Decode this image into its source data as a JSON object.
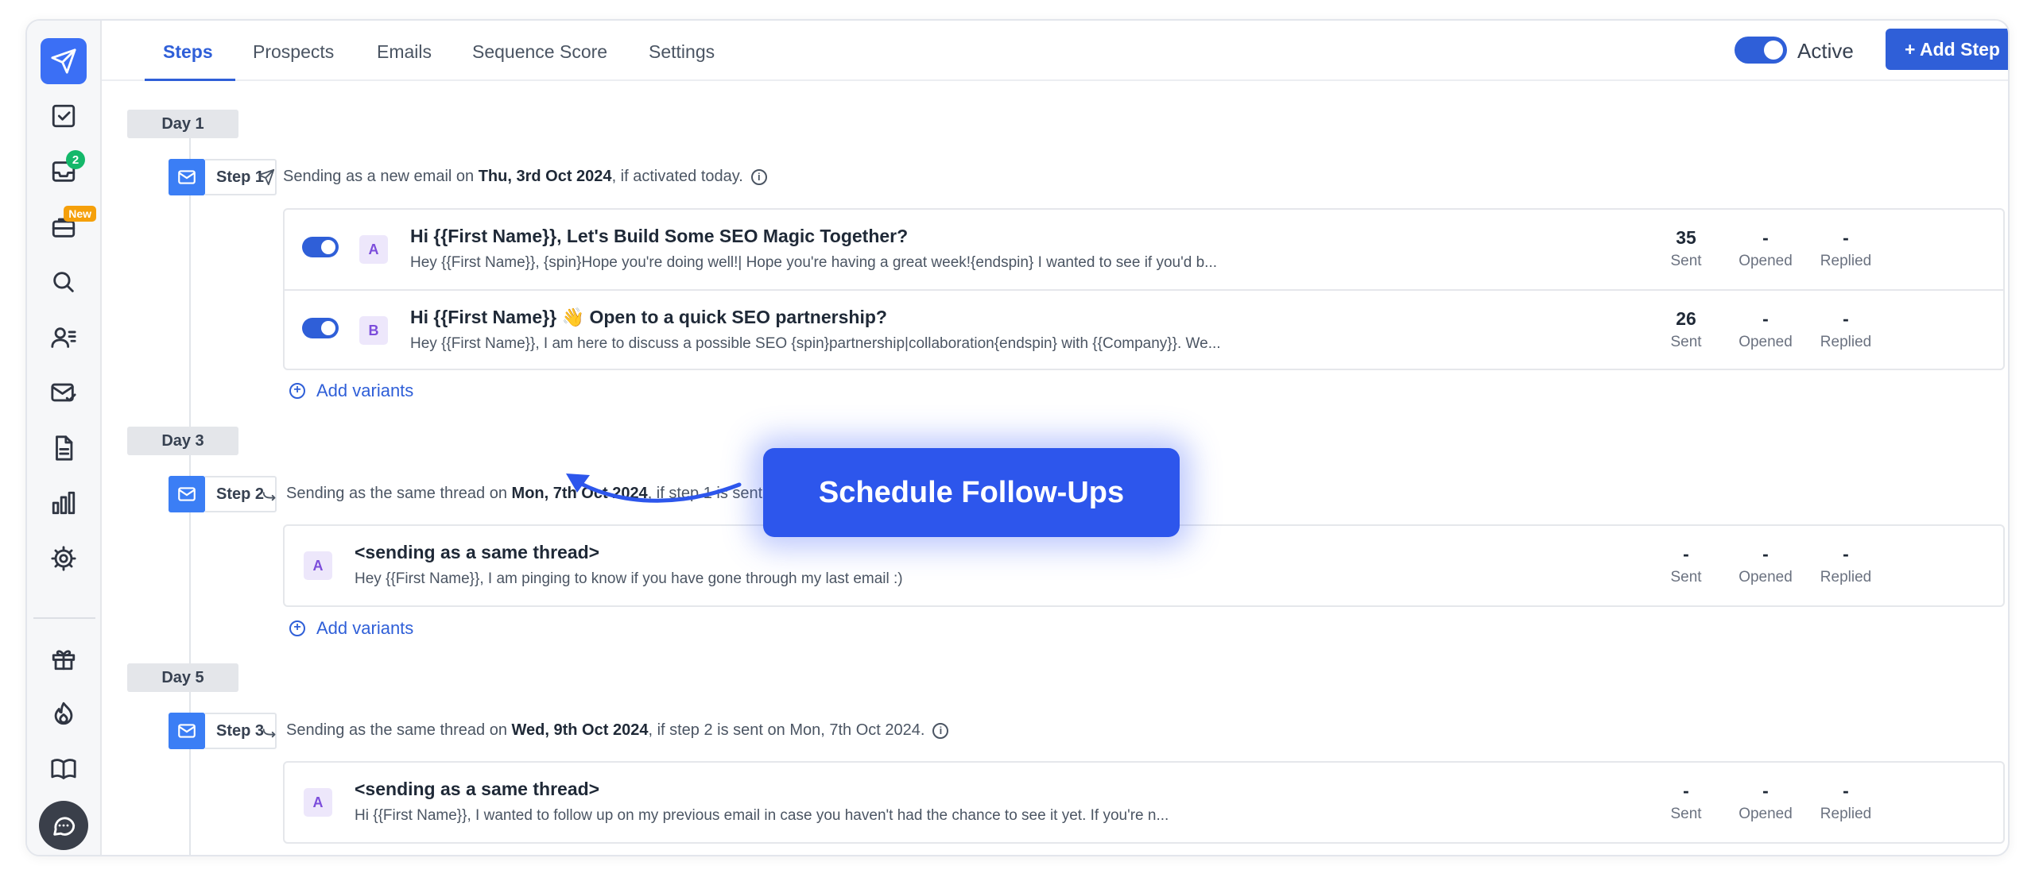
{
  "app": {
    "sidebar": {
      "inbox_badge": "2",
      "new_badge": "New"
    },
    "tabs": [
      "Steps",
      "Prospects",
      "Emails",
      "Sequence Score",
      "Settings"
    ],
    "active_label": "Active",
    "add_step_label": "+ Add Step"
  },
  "callout": "Schedule Follow-Ups",
  "stat_labels": {
    "sent": "Sent",
    "opened": "Opened",
    "replied": "Replied"
  },
  "add_variants_label": "Add variants",
  "days": [
    "Day 1",
    "Day 3",
    "Day 5"
  ],
  "steps": [
    {
      "label": "Step 1",
      "info_pre": "Sending as a new email on",
      "info_date": "Thu, 3rd Oct 2024",
      "info_post": ", if activated today.",
      "variants": [
        {
          "badge": "A",
          "subject": "Hi {{First Name}}, Let's Build Some SEO Magic Together?",
          "preview": "Hey {{First Name}}, {spin}Hope you're doing well!| Hope you're having a great week!{endspin} I wanted to see if you'd b...",
          "sent": "35",
          "opened": "-",
          "replied": "-"
        },
        {
          "badge": "B",
          "subject": "Hi {{First Name}} 👋 Open to a quick SEO partnership?",
          "preview": "Hey {{First Name}}, I am here to discuss a possible SEO {spin}partnership|collaboration{endspin} with {{Company}}. We...",
          "sent": "26",
          "opened": "-",
          "replied": "-"
        }
      ]
    },
    {
      "label": "Step 2",
      "info_pre": "Sending as the same thread on",
      "info_date": "Mon, 7th Oct 2024",
      "info_post": ", if step 1 is sent on Thu, 3rd Oct 2024.",
      "variants": [
        {
          "badge": "A",
          "subject": "<sending as a same thread>",
          "preview": "Hey {{First Name}},   I am pinging to know if you have gone through my last email :)",
          "sent": "-",
          "opened": "-",
          "replied": "-"
        }
      ]
    },
    {
      "label": "Step 3",
      "info_pre": "Sending as the same thread on",
      "info_date": "Wed, 9th Oct 2024",
      "info_post": ", if step 2 is sent on Mon, 7th Oct 2024.",
      "variants": [
        {
          "badge": "A",
          "subject": "<sending as a same thread>",
          "preview": "Hi {{First Name}}, I wanted to follow up on my previous email in case you haven't had the chance to see it yet. If you're n...",
          "sent": "-",
          "opened": "-",
          "replied": "-"
        }
      ]
    }
  ],
  "colors": {
    "accent": "#2f5fd8",
    "callout": "#2d56ec",
    "mail_icon": "#3b7ef5",
    "badge_green": "#14b86a",
    "badge_orange": "#f5a00b"
  }
}
